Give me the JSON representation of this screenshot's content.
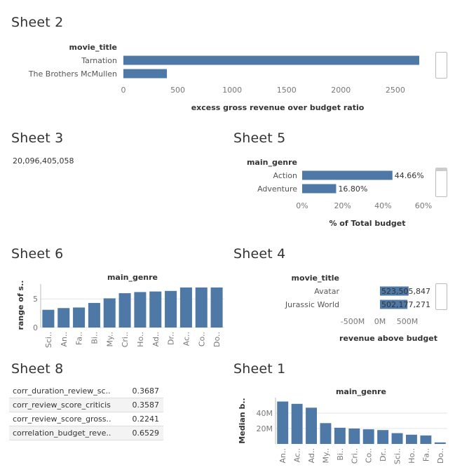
{
  "sheets": {
    "s2": "Sheet 2",
    "s3": "Sheet 3",
    "s5": "Sheet 5",
    "s6": "Sheet 6",
    "s4": "Sheet 4",
    "s8": "Sheet 8",
    "s1": "Sheet 1"
  },
  "sheet3_value": "20,096,405,058",
  "sheet8_rows": [
    {
      "name": "corr_duration_review_sc..",
      "value": "0.3687"
    },
    {
      "name": "corr_review_score_criticis",
      "value": "0.3587"
    },
    {
      "name": "corr_review_score_gross..",
      "value": "0.2241"
    },
    {
      "name": "correlation_budget_reve..",
      "value": "0.6529"
    }
  ],
  "colors": {
    "bar": "#4e79a7",
    "grid": "#e6e6e6",
    "axis": "#bbbbbb"
  },
  "chart_data": [
    {
      "id": "sheet2",
      "type": "bar",
      "orientation": "horizontal",
      "row_header": "movie_title",
      "categories": [
        "Tarnation",
        "The Brothers McMullen"
      ],
      "values": [
        2720,
        400
      ],
      "xlabel": "excess gross revenue over budget ratio",
      "xlim": [
        0,
        2720
      ],
      "ticks": [
        "0",
        "500",
        "1000",
        "1500",
        "2000",
        "2500"
      ]
    },
    {
      "id": "sheet5",
      "type": "bar",
      "orientation": "horizontal",
      "row_header": "main_genre",
      "categories": [
        "Action",
        "Adventure"
      ],
      "values": [
        44.66,
        16.8
      ],
      "data_labels": [
        "44.66%",
        "16.80%"
      ],
      "xlabel": "% of Total budget",
      "xlim": [
        0,
        60
      ],
      "ticks": [
        "0%",
        "20%",
        "40%",
        "60%"
      ]
    },
    {
      "id": "sheet6",
      "type": "bar",
      "orientation": "vertical",
      "column_header": "main_genre",
      "ylabel": "range of s..",
      "categories": [
        "Sci..",
        "An..",
        "Fa..",
        "Bi..",
        "My..",
        "Cri..",
        "Ho..",
        "Ad..",
        "Dr..",
        "Ac..",
        "Co..",
        "Do.."
      ],
      "values": [
        3.1,
        3.4,
        3.5,
        4.3,
        5.1,
        6.0,
        6.2,
        6.3,
        6.4,
        7.0,
        7.0,
        7.0
      ],
      "ylim": [
        0,
        7.6
      ],
      "yticks": [
        "0",
        "5"
      ]
    },
    {
      "id": "sheet4",
      "type": "bar",
      "orientation": "horizontal",
      "row_header": "movie_title",
      "categories": [
        "Avatar",
        "Jurassic World"
      ],
      "values": [
        523505847,
        502177271
      ],
      "data_labels": [
        "523,505,847",
        "502,177,271"
      ],
      "xlabel": "revenue above budget",
      "xlim": [
        -1000000000,
        1000000000
      ],
      "ticks": [
        "-500M",
        "0M",
        "500M"
      ]
    },
    {
      "id": "sheet1",
      "type": "bar",
      "orientation": "vertical",
      "column_header": "main_genre",
      "ylabel": "Median b..",
      "categories": [
        "An..",
        "Ac..",
        "Ad..",
        "My..",
        "Bi..",
        "Cri..",
        "Co..",
        "Dr..",
        "Sci..",
        "Ho..",
        "Fa..",
        "Do.."
      ],
      "values": [
        55,
        52,
        47,
        27,
        21,
        20,
        19,
        18,
        14,
        12,
        11,
        2
      ],
      "ylim": [
        0,
        60
      ],
      "yticks": [
        "20M",
        "40M"
      ]
    }
  ]
}
